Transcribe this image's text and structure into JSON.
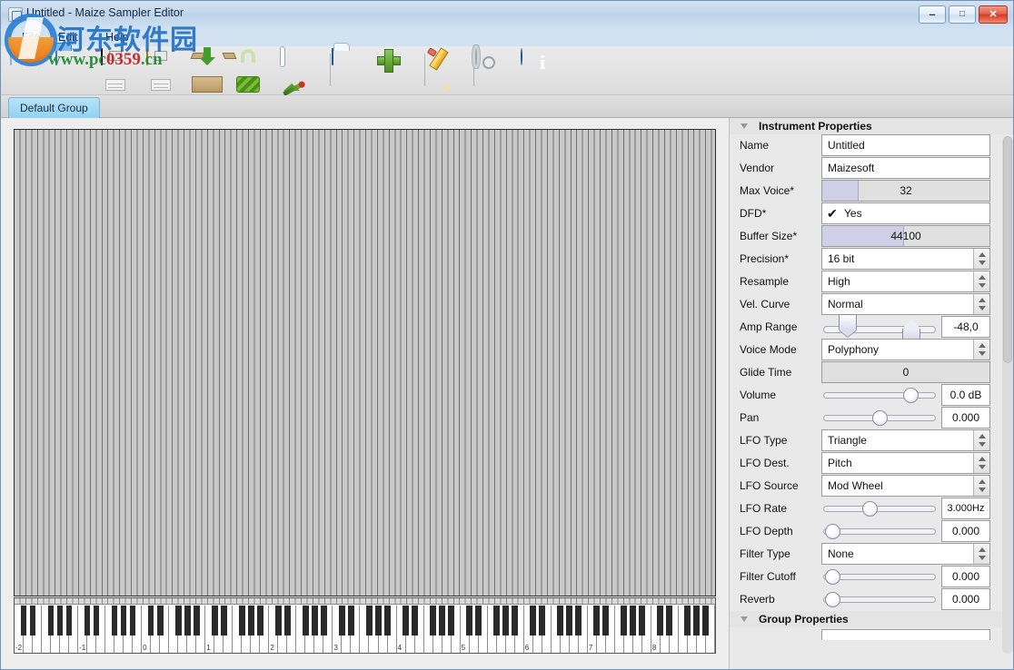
{
  "window": {
    "title": "Untitled - Maize Sampler Editor",
    "app_icon": "document-icon",
    "controls": {
      "minimize": "–",
      "maximize": "□",
      "close": "✕"
    }
  },
  "menubar": {
    "items": [
      {
        "label": "File"
      },
      {
        "label": "Edit"
      },
      {
        "label": "Help"
      }
    ]
  },
  "toolbar": {
    "buttons": [
      {
        "name": "new-instrument",
        "icon": "new-document-icon"
      },
      {
        "name": "open-instrument",
        "icon": "open-folder-icon"
      },
      {
        "name": "save-instrument",
        "icon": "save-floppy-icon"
      },
      {
        "name": "save-as-instrument",
        "icon": "save-as-floppy-icon"
      },
      {
        "name": "export-package",
        "icon": "export-box-icon"
      },
      {
        "name": "protect-instrument",
        "icon": "green-lock-icon"
      },
      {
        "name": "edit-skin",
        "icon": "image-brush-icon"
      },
      {
        "name": "add-group",
        "icon": "blue-folder-icon"
      },
      {
        "name": "add-sample",
        "icon": "green-plus-icon"
      },
      {
        "name": "edit-mapping",
        "icon": "pencil-icon"
      },
      {
        "name": "preferences",
        "icon": "gear-icon"
      },
      {
        "name": "about",
        "icon": "info-icon"
      }
    ]
  },
  "tabs": [
    {
      "label": "Default Group",
      "active": true
    }
  ],
  "keyboard": {
    "octave_labels": [
      "-2",
      "-1",
      "0",
      "1",
      "2",
      "3",
      "4",
      "5",
      "6",
      "7",
      "8"
    ],
    "octave_count": 11,
    "white_keys_per_octave": 7
  },
  "instrument_properties": {
    "title": "Instrument Properties",
    "collapse_icon": "triangle-down-icon",
    "rows": [
      {
        "label": "Name",
        "type": "text",
        "value": "Untitled"
      },
      {
        "label": "Vendor",
        "type": "text",
        "value": "Maizesoft"
      },
      {
        "label": "Max Voice*",
        "type": "drag",
        "value": "32",
        "fill_pct": 22
      },
      {
        "label": "DFD*",
        "type": "check",
        "value": "Yes",
        "checked": true
      },
      {
        "label": "Buffer Size*",
        "type": "drag",
        "value": "44100",
        "fill_pct": 49
      },
      {
        "label": "Precision*",
        "type": "combo",
        "value": "16 bit"
      },
      {
        "label": "Resample",
        "type": "combo",
        "value": "High"
      },
      {
        "label": "Vel. Curve",
        "type": "combo",
        "value": "Normal"
      },
      {
        "label": "Amp Range",
        "type": "range",
        "value": "-48,0",
        "lo_pct": 16,
        "hi_pct": 84
      },
      {
        "label": "Voice Mode",
        "type": "combo",
        "value": "Polyphony"
      },
      {
        "label": "Glide Time",
        "type": "drag",
        "value": "0",
        "fill_pct": 0
      },
      {
        "label": "Volume",
        "type": "slider",
        "value": "0.0 dB",
        "pos_pct": 82
      },
      {
        "label": "Pan",
        "type": "slider",
        "value": "0.000",
        "pos_pct": 50
      },
      {
        "label": "LFO Type",
        "type": "combo",
        "value": "Triangle"
      },
      {
        "label": "LFO Dest.",
        "type": "combo",
        "value": "Pitch"
      },
      {
        "label": "LFO Source",
        "type": "combo",
        "value": "Mod Wheel"
      },
      {
        "label": "LFO Rate",
        "type": "slider",
        "value": "3.000Hz",
        "pos_pct": 40
      },
      {
        "label": "LFO Depth",
        "type": "slider",
        "value": "0.000",
        "pos_pct": 2
      },
      {
        "label": "Filter Type",
        "type": "combo",
        "value": "None"
      },
      {
        "label": "Filter Cutoff",
        "type": "slider",
        "value": "0.000",
        "pos_pct": 2
      },
      {
        "label": "Reverb",
        "type": "slider",
        "value": "0.000",
        "pos_pct": 2
      }
    ]
  },
  "group_properties": {
    "title": "Group Properties",
    "collapse_icon": "triangle-down-icon"
  },
  "watermark": {
    "site_cn": "河东软件园",
    "url_green": "www.pc",
    "url_red": "0359",
    "url_green2": ".cn"
  },
  "colors": {
    "titlebar": "#c3d7ec",
    "tab_active": "#8fd2f2",
    "close_button": "#d43b22",
    "panel_bg": "#e9e9e9",
    "grid_bg": "#c9c9c9",
    "accent_blue": "#1f6fc4"
  }
}
